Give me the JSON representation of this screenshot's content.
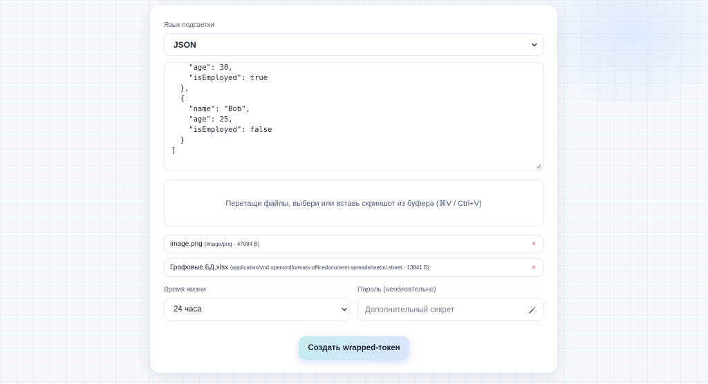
{
  "form": {
    "language_label": "Язык подсветки",
    "language_value": "JSON",
    "code_text": "    \"age\": 30,\n    \"isEmployed\": true\n  },\n  {\n    \"name\": \"Bob\",\n    \"age\": 25,\n    \"isEmployed\": false\n  }\n]",
    "dropzone_text": "Перетащи файлы, выбери или вставь скриншот из буфера (⌘V / Ctrl+V)",
    "files": [
      {
        "name": "image.png",
        "meta": "(image/png · 47084 B)",
        "remove": "×"
      },
      {
        "name": "Графовые БД.xlsx",
        "meta": "(application/vnd.openxmlformats-officedocument.spreadsheetml.sheet · 13841 B)",
        "remove": "×"
      }
    ],
    "ttl_label": "Время жизни",
    "ttl_value": "24 часа",
    "password_label": "Пароль (необязательно)",
    "password_placeholder": "Дополнительный секрет",
    "password_value": "",
    "submit_label": "Создать wrapped-токен"
  },
  "icons": {
    "select_chevron": "chevron-down-icon",
    "generate_password": "magic-wand-icon",
    "remove_file": "close-icon",
    "resize": "resize-handle-icon"
  },
  "colors": {
    "card_bg": "#ffffff",
    "page_bg": "#f4f7fb",
    "field_border": "#e6eaf0",
    "remove_red": "#e05a6a",
    "button_gradient_start": "#c6ecef",
    "button_gradient_end": "#dae6fb"
  }
}
